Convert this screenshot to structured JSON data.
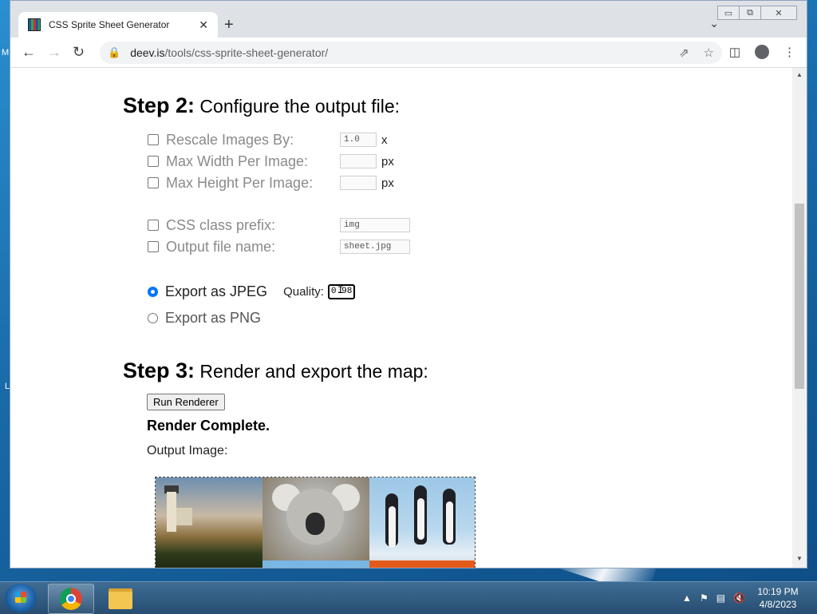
{
  "desktop": {
    "left_glyph": "M",
    "left_glyph2": "L"
  },
  "browser": {
    "tab_title": "CSS Sprite Sheet Generator",
    "tab_close": "✕",
    "new_tab": "+",
    "tab_menu": "⌄",
    "url_host": "deev.is",
    "url_path": "/tools/css-sprite-sheet-generator/",
    "win_minimize": "▭",
    "win_maximize": "⧉",
    "win_close": "✕"
  },
  "step2": {
    "label": "Step 2:",
    "title": " Configure the output file:",
    "options": [
      {
        "label": "Rescale Images By:",
        "value": "1.0",
        "unit": "x"
      },
      {
        "label": "Max Width Per Image:",
        "value": "",
        "unit": "px"
      },
      {
        "label": "Max Height Per Image:",
        "value": "",
        "unit": "px"
      },
      {
        "label": "CSS class prefix:",
        "value": "img",
        "unit": ""
      },
      {
        "label": "Output file name:",
        "value": "sheet.jpg",
        "unit": ""
      }
    ],
    "export_jpeg": "Export as JPEG",
    "quality_label": "Quality:",
    "quality_value": "0.98",
    "export_png": "Export as PNG"
  },
  "step3": {
    "label": "Step 3:",
    "title": " Render and export the map:",
    "run_button": "Run Renderer",
    "status": "Render Complete.",
    "output_label": "Output Image:"
  },
  "taskbar": {
    "time": "10:19 PM",
    "date": "4/8/2023",
    "tray_arrow": "▲"
  }
}
